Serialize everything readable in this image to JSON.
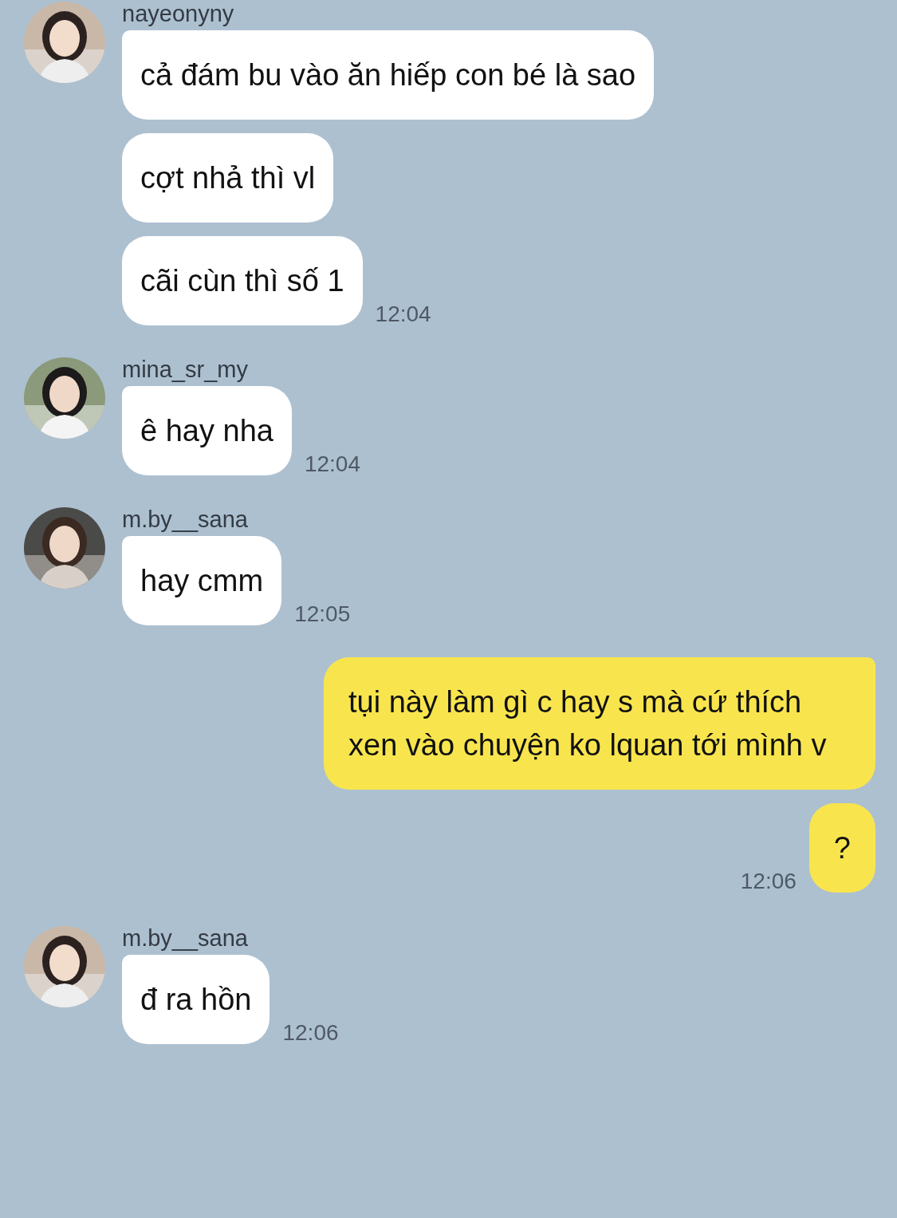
{
  "messages": [
    {
      "kind": "incoming",
      "sender": "nayeonyny",
      "bubbles": [
        {
          "text": "cả đám bu vào ăn hiếp con bé là sao"
        },
        {
          "text": "cợt nhả thì vl"
        },
        {
          "text": "cãi cùn thì số 1",
          "time": "12:04"
        }
      ]
    },
    {
      "kind": "incoming",
      "sender": "mina_sr_my",
      "bubbles": [
        {
          "text": "ê hay nha",
          "time": "12:04"
        }
      ]
    },
    {
      "kind": "incoming",
      "sender": "m.by__sana",
      "bubbles": [
        {
          "text": "hay cmm",
          "time": "12:05"
        }
      ]
    },
    {
      "kind": "outgoing",
      "bubbles": [
        {
          "text": "tụi này làm gì c hay s mà cứ thích xen vào chuyện ko lquan tới mình v"
        },
        {
          "text": "?",
          "time": "12:06"
        }
      ]
    },
    {
      "kind": "incoming",
      "sender": "m.by__sana",
      "bubbles": [
        {
          "text": "đ ra hồn",
          "time": "12:06"
        }
      ]
    }
  ]
}
